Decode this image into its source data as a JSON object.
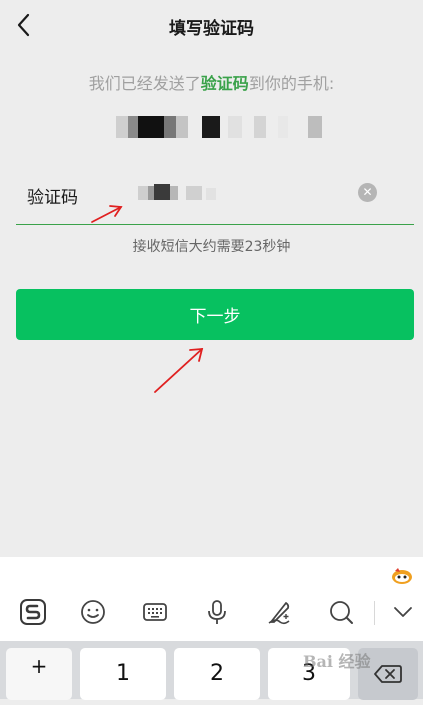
{
  "header": {
    "title": "填写验证码",
    "back_icon": "chevron-left-icon"
  },
  "hint": {
    "prefix": "我们已经发送了",
    "highlight": "验证码",
    "suffix": "到你的手机:"
  },
  "code_field": {
    "label": "验证码",
    "value": "",
    "clear_icon": "close-circle-icon"
  },
  "countdown": "接收短信大约需要23秒钟",
  "next_button": {
    "label": "下一步"
  },
  "keyboard": {
    "toolbar": [
      "sogou-logo-icon",
      "emoji-icon",
      "keyboard-icon",
      "microphone-icon",
      "handwriting-icon",
      "search-icon",
      "chevron-down-icon"
    ],
    "keys": {
      "symbol": "+",
      "k1": "1",
      "k2": "2",
      "k3": "3"
    },
    "delete_icon": "backspace-icon"
  },
  "watermark": "Bai 经验",
  "colors": {
    "accent": "#07c160",
    "highlight_text": "#3aa24a",
    "background": "#ededed",
    "annotation_arrow": "#e02020"
  }
}
